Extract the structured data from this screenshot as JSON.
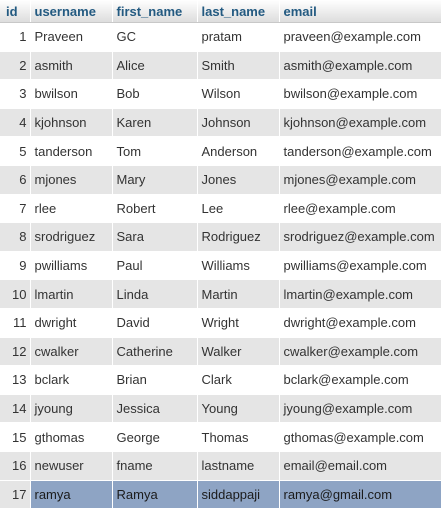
{
  "columns": {
    "id": "id",
    "username": "username",
    "first_name": "first_name",
    "last_name": "last_name",
    "email": "email"
  },
  "rows": [
    {
      "id": "1",
      "username": "Praveen",
      "first_name": "GC",
      "last_name": "pratam",
      "email": "praveen@example.com"
    },
    {
      "id": "2",
      "username": "asmith",
      "first_name": "Alice",
      "last_name": "Smith",
      "email": "asmith@example.com"
    },
    {
      "id": "3",
      "username": "bwilson",
      "first_name": "Bob",
      "last_name": "Wilson",
      "email": "bwilson@example.com"
    },
    {
      "id": "4",
      "username": "kjohnson",
      "first_name": "Karen",
      "last_name": "Johnson",
      "email": "kjohnson@example.com"
    },
    {
      "id": "5",
      "username": "tanderson",
      "first_name": "Tom",
      "last_name": "Anderson",
      "email": "tanderson@example.com"
    },
    {
      "id": "6",
      "username": "mjones",
      "first_name": "Mary",
      "last_name": "Jones",
      "email": "mjones@example.com"
    },
    {
      "id": "7",
      "username": "rlee",
      "first_name": "Robert",
      "last_name": "Lee",
      "email": "rlee@example.com"
    },
    {
      "id": "8",
      "username": "srodriguez",
      "first_name": "Sara",
      "last_name": "Rodriguez",
      "email": "srodriguez@example.com"
    },
    {
      "id": "9",
      "username": "pwilliams",
      "first_name": "Paul",
      "last_name": "Williams",
      "email": "pwilliams@example.com"
    },
    {
      "id": "10",
      "username": "lmartin",
      "first_name": "Linda",
      "last_name": "Martin",
      "email": "lmartin@example.com"
    },
    {
      "id": "11",
      "username": "dwright",
      "first_name": "David",
      "last_name": "Wright",
      "email": "dwright@example.com"
    },
    {
      "id": "12",
      "username": "cwalker",
      "first_name": "Catherine",
      "last_name": "Walker",
      "email": "cwalker@example.com"
    },
    {
      "id": "13",
      "username": "bclark",
      "first_name": "Brian",
      "last_name": "Clark",
      "email": "bclark@example.com"
    },
    {
      "id": "14",
      "username": "jyoung",
      "first_name": "Jessica",
      "last_name": "Young",
      "email": "jyoung@example.com"
    },
    {
      "id": "15",
      "username": "gthomas",
      "first_name": "George",
      "last_name": "Thomas",
      "email": "gthomas@example.com"
    },
    {
      "id": "16",
      "username": "newuser",
      "first_name": "fname",
      "last_name": "lastname",
      "email": "email@email.com"
    },
    {
      "id": "17",
      "username": "ramya",
      "first_name": "Ramya",
      "last_name": "siddappaji",
      "email": "ramya@gmail.com",
      "selected": true
    }
  ],
  "colors": {
    "header_text": "#235a81",
    "row_alt": "#e5e5e5",
    "selection": "#8ea4c4"
  }
}
